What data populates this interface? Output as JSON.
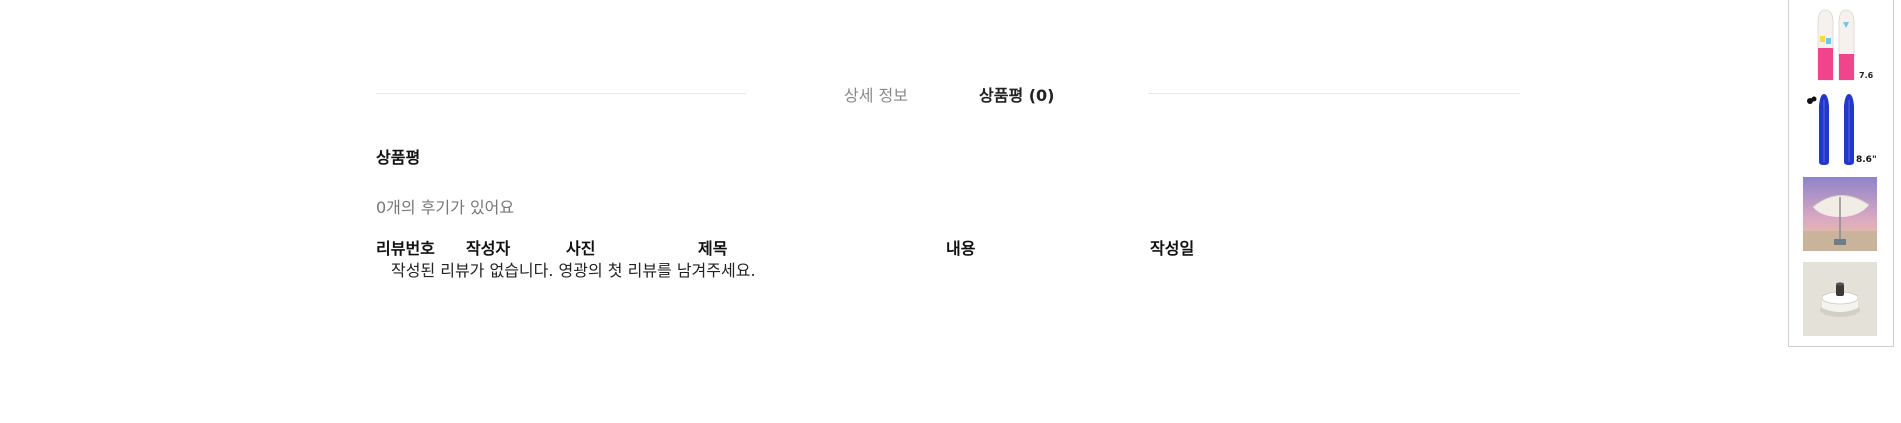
{
  "tabs": {
    "detail_label": "상세 정보",
    "review_label": "상품평 (0)"
  },
  "reviews": {
    "section_title": "상품평",
    "count_text": "0개의 후기가 있어요",
    "columns": [
      "리뷰번호",
      "작성자",
      "사진",
      "제목",
      "내용",
      "작성일"
    ],
    "empty_message": "작성된 리뷰가 없습니다. 영광의 첫 리뷰를 남겨주세요."
  },
  "recent_products": [
    {
      "name": "pink-surfboard-thumb",
      "size_label": "7.6"
    },
    {
      "name": "blue-surfboard-thumb",
      "size_label": "8.6\""
    },
    {
      "name": "beach-umbrella-thumb"
    },
    {
      "name": "gas-canister-cap-thumb"
    }
  ],
  "colors": {
    "tab_inactive": "#8a8a8a",
    "divider": "#e6e6e6",
    "panel_border": "#cfcfcf"
  }
}
